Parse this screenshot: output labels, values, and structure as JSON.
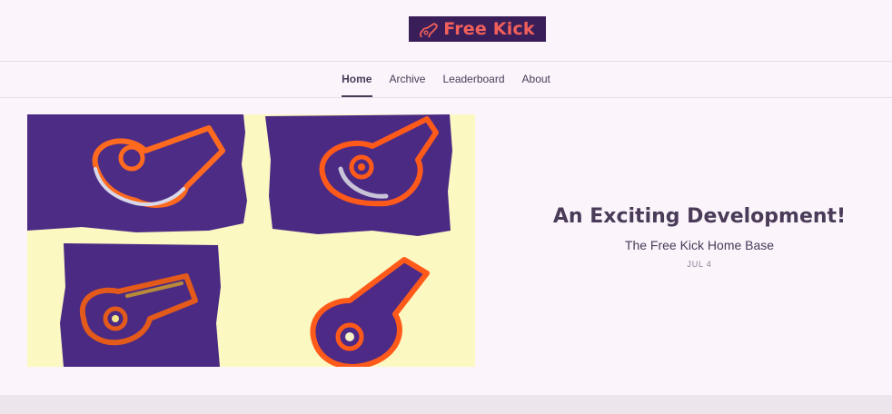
{
  "site": {
    "logo_text": "Free Kick",
    "logo_icon": "whistle-icon",
    "colors": {
      "background": "#fbf4fb",
      "logo_bg": "#3a1e5a",
      "logo_text": "#f0605a",
      "text": "#4a3b58",
      "muted": "#8a7f93",
      "footer_band": "#ece6ec"
    }
  },
  "nav": {
    "items": [
      {
        "label": "Home",
        "active": true
      },
      {
        "label": "Archive",
        "active": false
      },
      {
        "label": "Leaderboard",
        "active": false
      },
      {
        "label": "About",
        "active": false
      }
    ]
  },
  "featured_post": {
    "title": "An Exciting Development!",
    "subtitle": "The Free Kick Home Base",
    "date": "JUL 4",
    "image_subject": "four painted whistles in orange on purple and yellow"
  }
}
